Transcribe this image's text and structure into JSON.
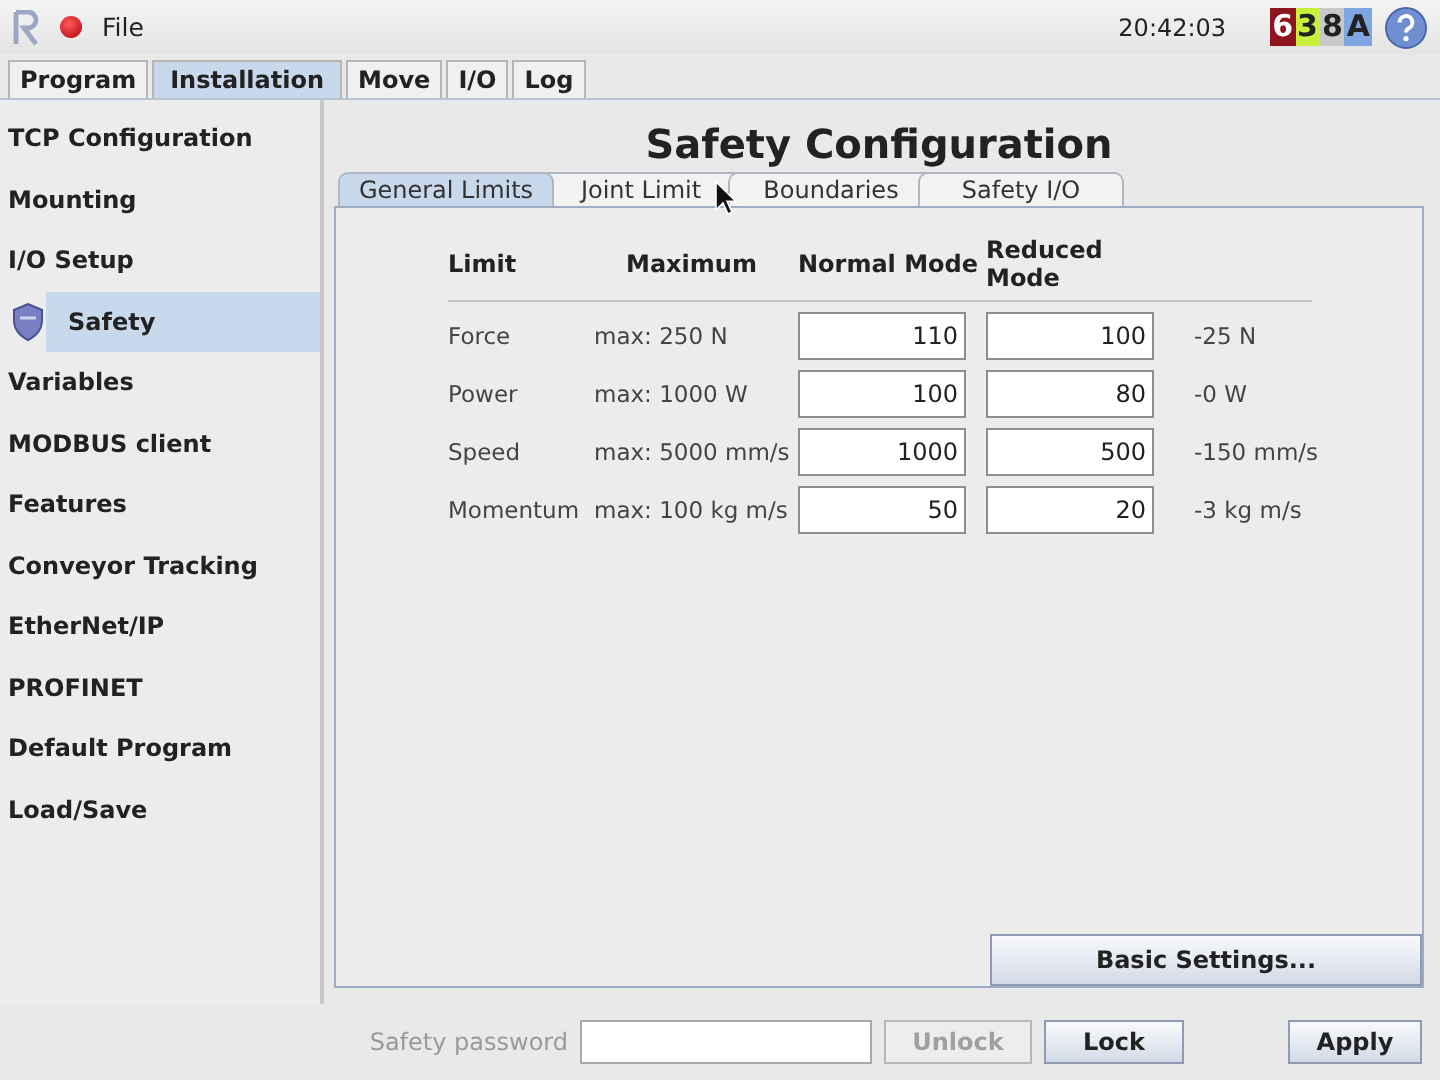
{
  "header": {
    "menu": "File",
    "time": "20:42:03",
    "status_code": [
      {
        "text": "6",
        "color": "#8e1420"
      },
      {
        "text": "3",
        "color": "#c8f03c"
      },
      {
        "text": "8",
        "color": "#c8c8c8"
      },
      {
        "text": "A",
        "color": "#7fa6e0"
      }
    ]
  },
  "tabs": [
    {
      "label": "Program",
      "selected": false
    },
    {
      "label": "Installation",
      "selected": true
    },
    {
      "label": "Move",
      "selected": false
    },
    {
      "label": "I/O",
      "selected": false
    },
    {
      "label": "Log",
      "selected": false
    }
  ],
  "sidebar": {
    "items": [
      {
        "label": "TCP Configuration",
        "selected": false
      },
      {
        "label": "Mounting",
        "selected": false
      },
      {
        "label": "I/O Setup",
        "selected": false
      },
      {
        "label": "Safety",
        "selected": true,
        "kind": "shield"
      },
      {
        "label": "Variables",
        "selected": false
      },
      {
        "label": "MODBUS client",
        "selected": false
      },
      {
        "label": "Features",
        "selected": false
      },
      {
        "label": "Conveyor Tracking",
        "selected": false
      },
      {
        "label": "EtherNet/IP",
        "selected": false
      },
      {
        "label": "PROFINET",
        "selected": false
      },
      {
        "label": "Default Program",
        "selected": false
      },
      {
        "label": "Load/Save",
        "selected": false
      }
    ]
  },
  "title": "Safety Configuration",
  "subtabs": [
    {
      "label": "General Limits",
      "selected": true
    },
    {
      "label": "Joint Limit",
      "selected": false
    },
    {
      "label": "Boundaries",
      "selected": false
    },
    {
      "label": "Safety I/O",
      "selected": false
    }
  ],
  "table": {
    "columns": [
      "Limit",
      "Maximum",
      "Normal Mode",
      "Reduced Mode"
    ],
    "rows": [
      {
        "limit": "Force",
        "maximum": "max: 250 N",
        "normal": "110",
        "reduced": "100",
        "difference": "-25 N"
      },
      {
        "limit": "Power",
        "maximum": "max: 1000 W",
        "normal": "100",
        "reduced": "80",
        "difference": "-0 W"
      },
      {
        "limit": "Speed",
        "maximum": "max: 5000 mm/s",
        "normal": "1000",
        "reduced": "500",
        "difference": "-150 mm/s"
      },
      {
        "limit": "Momentum",
        "maximum": "max: 100 kg m/s",
        "normal": "50",
        "reduced": "20",
        "difference": "-3 kg m/s"
      }
    ]
  },
  "basic_settings_button": "Basic Settings...",
  "footer": {
    "password_label": "Safety password",
    "buttons": [
      {
        "label": "Unlock",
        "disabled": true
      },
      {
        "label": "Lock",
        "disabled": false
      },
      {
        "label": "Apply",
        "disabled": false
      }
    ]
  }
}
